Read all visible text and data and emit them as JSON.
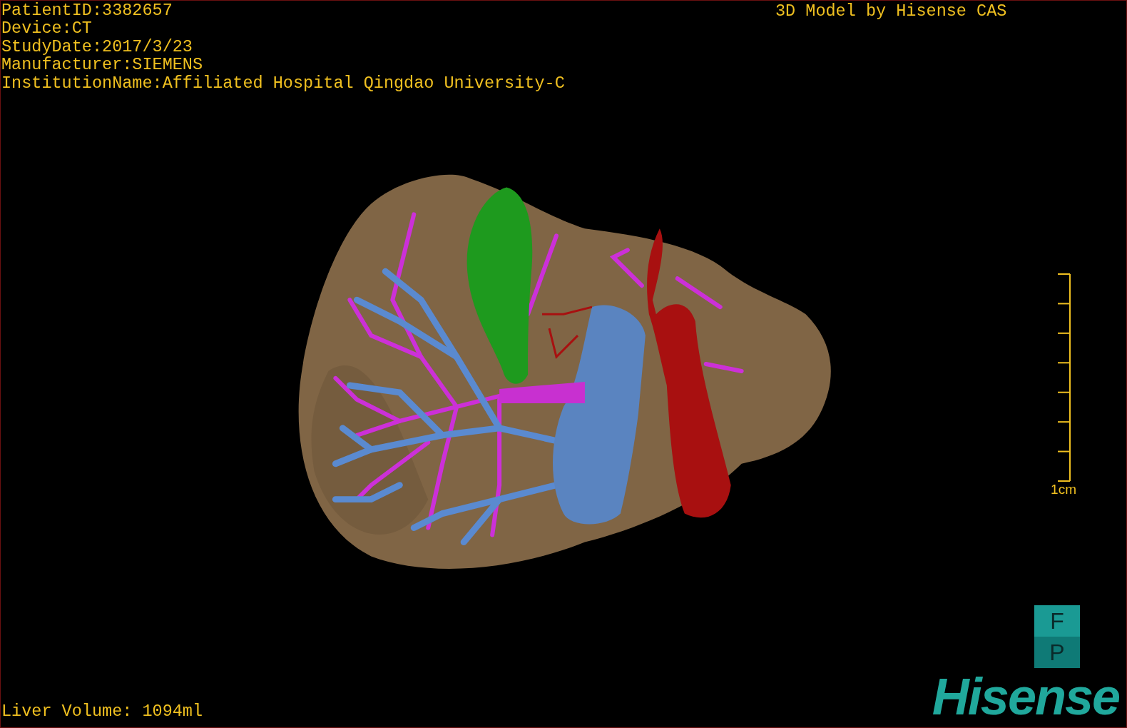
{
  "patient_info": [
    "PatientID:3382657",
    "Device:CT",
    "StudyDate:2017/3/23",
    "Manufacturer:SIEMENS",
    "InstitutionName:Affiliated Hospital Qingdao University-C"
  ],
  "title": "3D Model by Hisense CAS",
  "scale_bar": {
    "label": "1cm"
  },
  "orientation_cube": {
    "faces": [
      "F",
      "P"
    ]
  },
  "liver_volume": "Liver Volume: 1094ml",
  "logo": "Hisense"
}
